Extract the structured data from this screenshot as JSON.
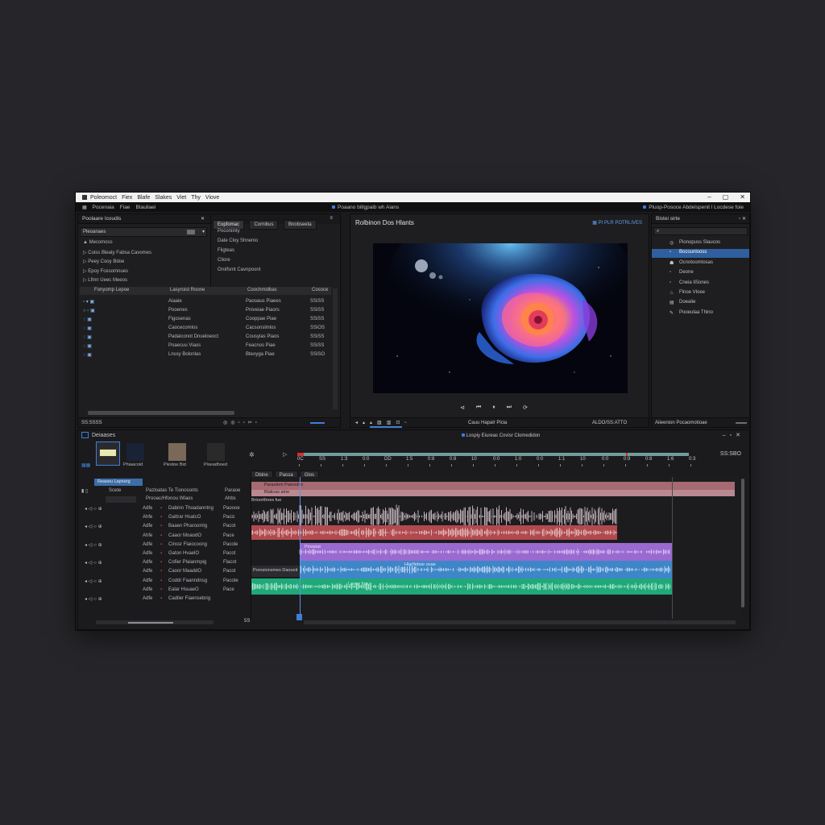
{
  "window": {
    "menu": [
      "Poleomoct",
      "Fiex",
      "Blafe",
      "Slakes",
      "Viet",
      "Thy",
      "Viove"
    ],
    "subbar_left": [
      "Pocenaia",
      "Fiae",
      "Btauliaei"
    ],
    "subbar_center": "Poaano bitlgpaib wh Aians",
    "subbar_right": "Pluop-Posoce Abdelspenit l Locdese foie"
  },
  "project_panel": {
    "title": "Poolaare Icoudis",
    "search_label": "Pleoanaes",
    "tree": [
      "Mecomoss",
      "Bleaty Fabsa Cavomes",
      "Cooy Bdoe",
      "Fcesomnues",
      "Ueec Meeos"
    ],
    "tree_prefix": [
      "",
      "Coiss",
      "Peey",
      "Epoy",
      "Lfmn"
    ],
    "tabs": [
      "Eopfomac",
      "Cornibus",
      "Bnobseeta"
    ],
    "tab_items": [
      "Poconiinty",
      "Date Cloy Shnenio",
      "Fligteas",
      "Cliore",
      "Orolfsmt Cavnpoont"
    ],
    "columns": [
      "Fonyomp Lepoe",
      "Lasyroist Roone",
      "Coochmidbas",
      "Cosoce"
    ],
    "rows": [
      {
        "name": "Aiaaie",
        "type": "Paooaus Piaees",
        "dur": "SSiSS"
      },
      {
        "name": "Pooenes",
        "type": "Pniveiae Piaors",
        "dur": "SSiSS"
      },
      {
        "name": "Figosenas",
        "type": "Cooppae Piae",
        "dur": "SSiSS"
      },
      {
        "name": "Caocecomlos",
        "type": "Cacsonslmlos",
        "dur": "SSiOS"
      },
      {
        "name": "Padaiconot Dnueloeoct",
        "type": "Cousyias Piaos",
        "dur": "SSiSS"
      },
      {
        "name": "Poaecuu Viaos",
        "type": "Feacnos Piae",
        "dur": "SSiSS"
      },
      {
        "name": "Lnssy Bolonlas",
        "type": "Bteoyga Piae",
        "dur": "SSiSO"
      }
    ],
    "footer_time": "SS:SSSS"
  },
  "program_panel": {
    "title": "Rolbinon Dos Hlants",
    "badge": "PI PLR POTRLIVES",
    "timecode": "ALDO/SS:ATTO",
    "footer_label": "Cauu Hapalr Plcia"
  },
  "effects_panel": {
    "title": "Bistei sirte",
    "items": [
      "Pionopuss Slaucos",
      "Bocounlooss",
      "Ocnotoomtosas",
      "Deone",
      "Cneia liSones",
      "Flnoe Vloee",
      "Doealie",
      "Pooeulaa Thino"
    ],
    "footer_label": "Aiieenion Pocaomotioae"
  },
  "timeline": {
    "title": "Deiaases",
    "sequence_name": "Lospiy Eiureas Covisr Clomedidon",
    "timecode": "SS:SBO",
    "ruler": [
      "0C",
      "SS",
      "1:3",
      "0:0",
      "DD",
      "1:5",
      "0:8",
      "0:8",
      "10",
      "0:0",
      "1:0",
      "0:0",
      "1:1",
      "10",
      "0:0",
      "0:9",
      "0:8",
      "1:6",
      "0:3"
    ],
    "bins": [
      "",
      "Phiaacoid",
      "Piestoe Bid",
      "Piseadhoed"
    ],
    "header_tab": "Reaseu Lapnerg",
    "header_cols": [
      "Scete",
      "Pazloatas Te Tionosonts",
      "Paraoe"
    ],
    "clip_name": "Prooac/Hfonou Wlaos",
    "clip_type": "Ahbs",
    "clip_top_label": "Paraolem Paieodne",
    "clip_top_label2": "Blalicas ame",
    "clip_sub_label": "Brioorthnes fue",
    "clip_purple_label": "Pinoeiat",
    "clip_blue_label": "Porosionsmes Daouoit",
    "clip_blue_top": "Hlarfleboe ooae",
    "clip_green_label": "Laone fos",
    "tab_small": [
      "Dbine",
      "Pacoa",
      "Glos"
    ],
    "tracks": [
      {
        "id": "Adfe",
        "name": "Dabinn Thoadanntng",
        "val": "Paoooe"
      },
      {
        "id": "Ahfe",
        "name": "Gattrar HsatcO",
        "val": "Pacic"
      },
      {
        "id": "Adfe",
        "name": "Baaen Pharoomlg",
        "val": "Pacot"
      },
      {
        "id": "Ahfe",
        "name": "Caaor MoaodO",
        "val": "Pace"
      },
      {
        "id": "Adfe",
        "name": "Cinssr Flaiocoong",
        "val": "Pacole"
      },
      {
        "id": "Adfe",
        "name": "Gaton HvaelO",
        "val": "Pacot"
      },
      {
        "id": "Adfe",
        "name": "Cofier Plaianmpig",
        "val": "Flacot"
      },
      {
        "id": "Adfe",
        "name": "Caoor MaaddO",
        "val": "Pacot"
      },
      {
        "id": "Adfe",
        "name": "Coddr Faanndnsg",
        "val": "Pacote"
      },
      {
        "id": "Adfe",
        "name": "Ealar HsuaeO",
        "val": "Pace"
      },
      {
        "id": "Adfe",
        "name": "Cadiler Fiaensebrig",
        "val": ""
      }
    ],
    "footer_num": "5S"
  },
  "colors": {
    "accent": "#3d7fd6",
    "clip_red": "#b04a4e",
    "clip_pink": "#c89aa2",
    "clip_purple": "#9a6ad0",
    "clip_blue": "#3f86c8",
    "clip_green": "#20a878",
    "playhead": "#3d7fd6"
  }
}
